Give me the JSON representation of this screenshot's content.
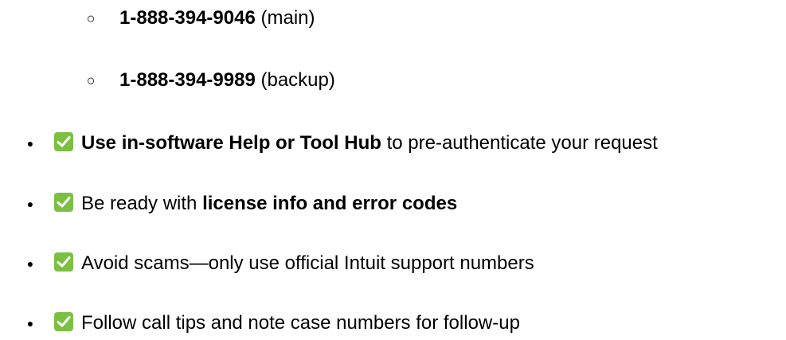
{
  "sub_items": [
    {
      "number": "1-888-394-9046",
      "note": " (main)"
    },
    {
      "number": "1-888-394-9989",
      "note": " (backup)"
    }
  ],
  "items": [
    {
      "icon": "check-mark-icon",
      "bold": "Use in-software Help or Tool Hub",
      "rest": " to pre-authenticate your request"
    },
    {
      "icon": "check-mark-icon",
      "lead": "Be ready with ",
      "bold": "license info and error codes"
    },
    {
      "icon": "check-mark-icon",
      "lead": "Avoid scams—only use official Intuit support numbers"
    },
    {
      "icon": "check-mark-icon",
      "lead": "Follow call tips and note case numbers for follow-up"
    }
  ],
  "colors": {
    "check_bg": "#7cc043",
    "text": "#000000"
  }
}
